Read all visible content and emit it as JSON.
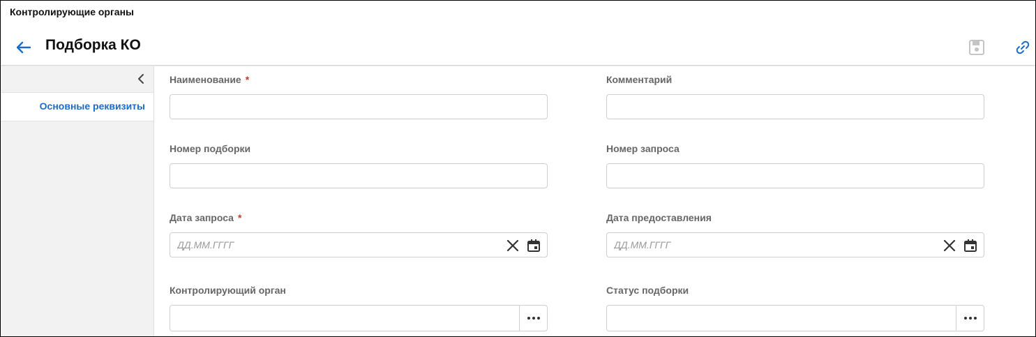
{
  "app": {
    "title": "Контролирующие органы"
  },
  "header": {
    "title": "Подборка КО"
  },
  "sidebar": {
    "items": [
      {
        "label": "Основные реквизиты"
      }
    ]
  },
  "form": {
    "required_mark": "*",
    "fields": [
      {
        "label": "Наименование",
        "value": "",
        "required": true
      },
      {
        "label": "Комментарий",
        "value": ""
      },
      {
        "label": "Номер подборки",
        "value": ""
      },
      {
        "label": "Номер запроса",
        "value": ""
      },
      {
        "label": "Дата запроса",
        "placeholder": "ДД.ММ.ГГГГ",
        "value": "",
        "required": true
      },
      {
        "label": "Дата предоставления",
        "placeholder": "ДД.ММ.ГГГГ",
        "value": ""
      },
      {
        "label": "Контролирующий орган",
        "value": ""
      },
      {
        "label": "Статус подборки",
        "value": ""
      }
    ]
  },
  "colors": {
    "accent": "#1a6cc7",
    "required": "#c0392b",
    "label": "#666666",
    "sidebar_bg": "#f2f2f2"
  },
  "icons": {
    "back": "arrow-left-icon",
    "save": "save-icon",
    "link": "link-icon",
    "collapse": "chevron-left-icon",
    "clear": "close-icon",
    "calendar": "calendar-icon",
    "more": "more-dots-icon"
  }
}
